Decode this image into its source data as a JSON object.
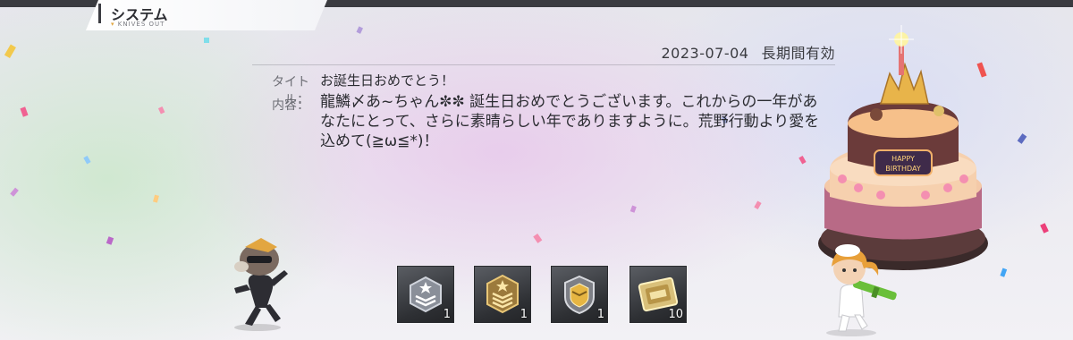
{
  "header": {
    "title": "システム",
    "subtitle": "KNIVES OUT"
  },
  "mail": {
    "date": "2023-07-04",
    "validity": "長期間有効",
    "title_label": "タイトル：",
    "title_value": "お誕生日おめでとう！",
    "content_label": "内容：",
    "content_value": "龍鱗〆あ~ちゃん✼✼ 誕生日おめでとうございます。これからの一年があなたにとって、さらに素晴らしい年でありますように。荒野行動より愛を込めて(≧ω≦*)！"
  },
  "cake_sign": {
    "line1": "HAPPY",
    "line2": "BIRTHDAY"
  },
  "rewards": [
    {
      "name": "silver-rank-badge",
      "count": "1"
    },
    {
      "name": "gold-rank-badge",
      "count": "1"
    },
    {
      "name": "gold-shield-badge",
      "count": "1"
    },
    {
      "name": "gold-ticket",
      "count": "10"
    }
  ],
  "colors": {
    "topbar": "#3a3b40",
    "accent": "#e2a640",
    "text": "#2b2c31"
  }
}
